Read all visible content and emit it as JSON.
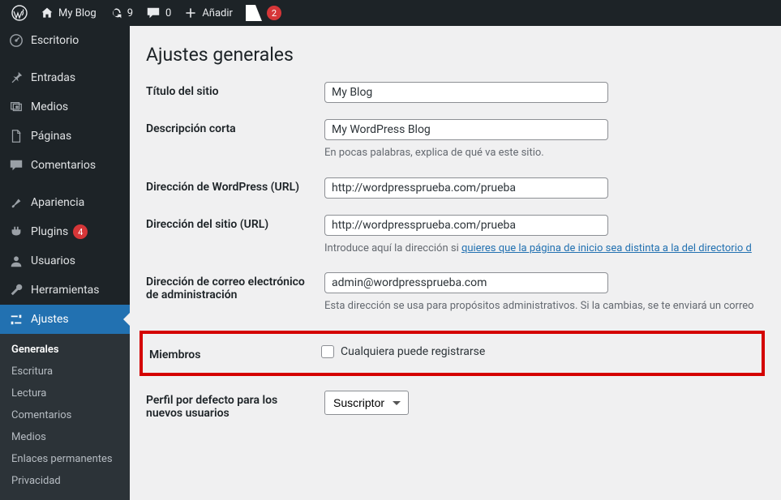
{
  "adminbar": {
    "site_title": "My Blog",
    "updates_count": "9",
    "comments_count": "0",
    "add_new_label": "Añadir",
    "yoast_count": "2"
  },
  "menu": {
    "dashboard": "Escritorio",
    "posts": "Entradas",
    "media": "Medios",
    "pages": "Páginas",
    "comments": "Comentarios",
    "appearance": "Apariencia",
    "plugins": "Plugins",
    "plugins_updates": "4",
    "users": "Usuarios",
    "tools": "Herramientas",
    "settings": "Ajustes",
    "sub": {
      "general": "Generales",
      "writing": "Escritura",
      "reading": "Lectura",
      "discussion": "Comentarios",
      "media": "Medios",
      "permalinks": "Enlaces permanentes",
      "privacy": "Privacidad"
    }
  },
  "page": {
    "title": "Ajustes generales",
    "rows": {
      "site_title_label": "Título del sitio",
      "site_title_value": "My Blog",
      "tagline_label": "Descripción corta",
      "tagline_value": "My WordPress Blog",
      "tagline_desc": "En pocas palabras, explica de qué va este sitio.",
      "wp_url_label": "Dirección de WordPress (URL)",
      "wp_url_value": "http://wordpressprueba.com/prueba",
      "site_url_label": "Dirección del sitio (URL)",
      "site_url_value": "http://wordpressprueba.com/prueba",
      "site_url_desc_pre": "Introduce aquí la dirección si ",
      "site_url_desc_link": "quieres que la página de inicio sea distinta a la del directorio d",
      "admin_email_label": "Dirección de correo electrónico de administración",
      "admin_email_value": "admin@wordpressprueba.com",
      "admin_email_desc": "Esta dirección se usa para propósitos administrativos. Si la cambias, se te enviará un correo",
      "membership_label": "Miembros",
      "membership_checkbox_label": "Cualquiera puede registrarse",
      "default_role_label": "Perfil por defecto para los nuevos usuarios",
      "default_role_value": "Suscriptor"
    }
  }
}
